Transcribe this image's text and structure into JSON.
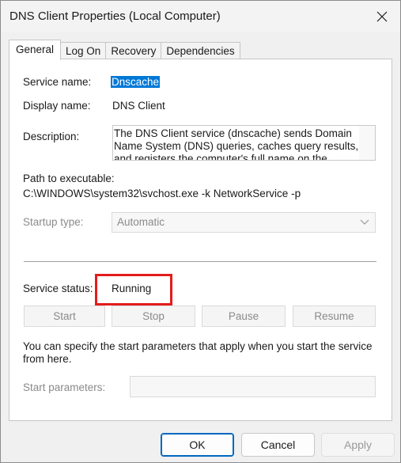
{
  "window": {
    "title": "DNS Client Properties (Local Computer)"
  },
  "tabs": [
    {
      "label": "General",
      "active": true
    },
    {
      "label": "Log On",
      "active": false
    },
    {
      "label": "Recovery",
      "active": false
    },
    {
      "label": "Dependencies",
      "active": false
    }
  ],
  "general": {
    "service_name_label": "Service name:",
    "service_name_value": "Dnscache",
    "display_name_label": "Display name:",
    "display_name_value": "DNS Client",
    "description_label": "Description:",
    "description_value": "The DNS Client service (dnscache) sends Domain Name System (DNS) queries, caches query results, and registers the computer's full name on the",
    "path_label": "Path to executable:",
    "path_value": "C:\\WINDOWS\\system32\\svchost.exe -k NetworkService -p",
    "startup_type_label": "Startup type:",
    "startup_type_value": "Automatic",
    "service_status_label": "Service status:",
    "service_status_value": "Running",
    "buttons": {
      "start": "Start",
      "stop": "Stop",
      "pause": "Pause",
      "resume": "Resume"
    },
    "hint_text_line1": "You can specify the start parameters that apply when you start the service",
    "hint_text_line2": "from here.",
    "start_params_label": "Start parameters:",
    "start_params_value": ""
  },
  "footer": {
    "ok": "OK",
    "cancel": "Cancel",
    "apply": "Apply"
  },
  "colors": {
    "selection": "#0078d7",
    "highlight_box": "#e41c1c",
    "primary_border": "#0067c0"
  },
  "icons": {
    "close": "close-icon",
    "dropdown": "chevron-down-icon"
  }
}
